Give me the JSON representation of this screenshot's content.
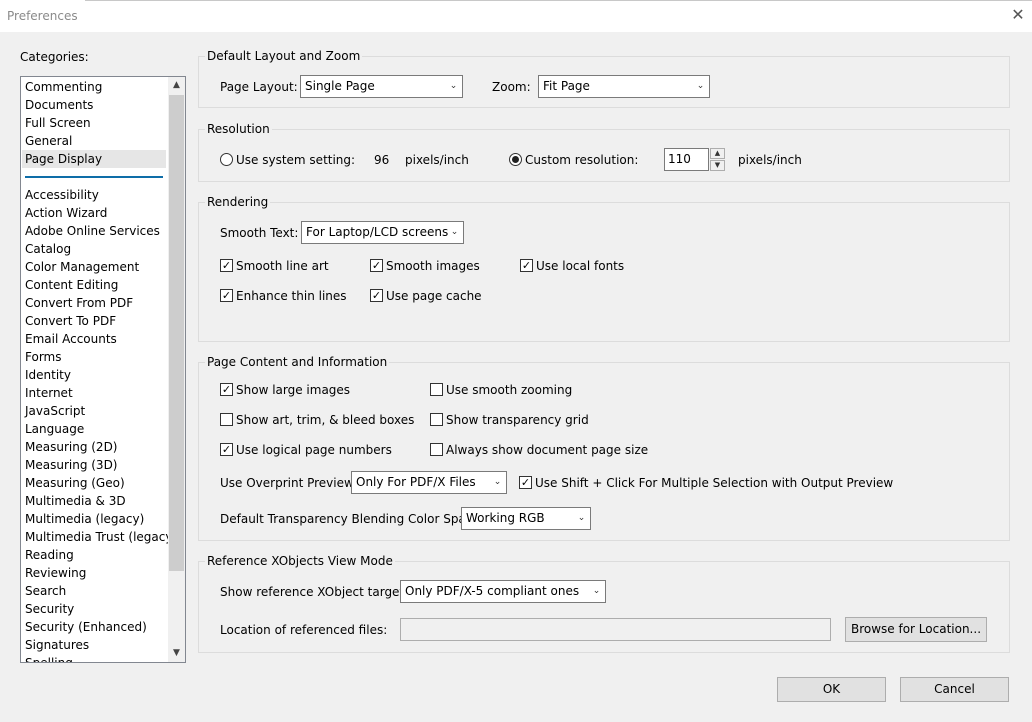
{
  "window": {
    "title": "Preferences",
    "close_label": "✕"
  },
  "categories": {
    "label": "Categories:",
    "top_items": [
      "Commenting",
      "Documents",
      "Full Screen",
      "General",
      "Page Display"
    ],
    "selected": "Page Display",
    "items": [
      "Accessibility",
      "Action Wizard",
      "Adobe Online Services",
      "Catalog",
      "Color Management",
      "Content Editing",
      "Convert From PDF",
      "Convert To PDF",
      "Email Accounts",
      "Forms",
      "Identity",
      "Internet",
      "JavaScript",
      "Language",
      "Measuring (2D)",
      "Measuring (3D)",
      "Measuring (Geo)",
      "Multimedia & 3D",
      "Multimedia (legacy)",
      "Multimedia Trust (legacy)",
      "Reading",
      "Reviewing",
      "Search",
      "Security",
      "Security (Enhanced)",
      "Signatures",
      "Spelling"
    ],
    "scroll_up": "▲",
    "scroll_down": "▼"
  },
  "layout_zoom": {
    "title": "Default Layout and Zoom",
    "page_layout_label": "Page Layout:",
    "page_layout_value": "Single Page",
    "zoom_label": "Zoom:",
    "zoom_value": "Fit Page"
  },
  "resolution": {
    "title": "Resolution",
    "system_label": "Use system setting:",
    "system_value": "96",
    "system_unit": "pixels/inch",
    "system_selected": false,
    "custom_label": "Custom resolution:",
    "custom_value": "110",
    "custom_unit": "pixels/inch",
    "custom_selected": true
  },
  "rendering": {
    "title": "Rendering",
    "smooth_text_label": "Smooth Text:",
    "smooth_text_value": "For Laptop/LCD screens",
    "smooth_line_art": "Smooth line art",
    "smooth_images": "Smooth images",
    "use_local_fonts": "Use local fonts",
    "enhance_thin_lines": "Enhance thin lines",
    "use_page_cache": "Use page cache"
  },
  "page_content": {
    "title": "Page Content and Information",
    "show_large_images": "Show large images",
    "use_smooth_zooming": "Use smooth zooming",
    "show_art_trim_bleed": "Show art, trim, & bleed boxes",
    "show_transparency_grid": "Show transparency grid",
    "use_logical_page_numbers": "Use logical page numbers",
    "always_show_page_size": "Always show document page size",
    "overprint_label": "Use Overprint Preview:",
    "overprint_value": "Only For PDF/X Files",
    "shift_click_label": "Use Shift + Click For Multiple Selection with Output Preview",
    "blending_label": "Default Transparency Blending Color Space:",
    "blending_value": "Working RGB"
  },
  "xobjects": {
    "title": "Reference XObjects View Mode",
    "targets_label": "Show reference XObject targets:",
    "targets_value": "Only PDF/X-5 compliant ones",
    "location_label": "Location of referenced files:",
    "location_value": "",
    "browse_label": "Browse for Location..."
  },
  "footer": {
    "ok_label": "OK",
    "cancel_label": "Cancel"
  },
  "check_mark": "✓",
  "dropdown_arrow": "⌄",
  "spin_up": "▲",
  "spin_down": "▼"
}
